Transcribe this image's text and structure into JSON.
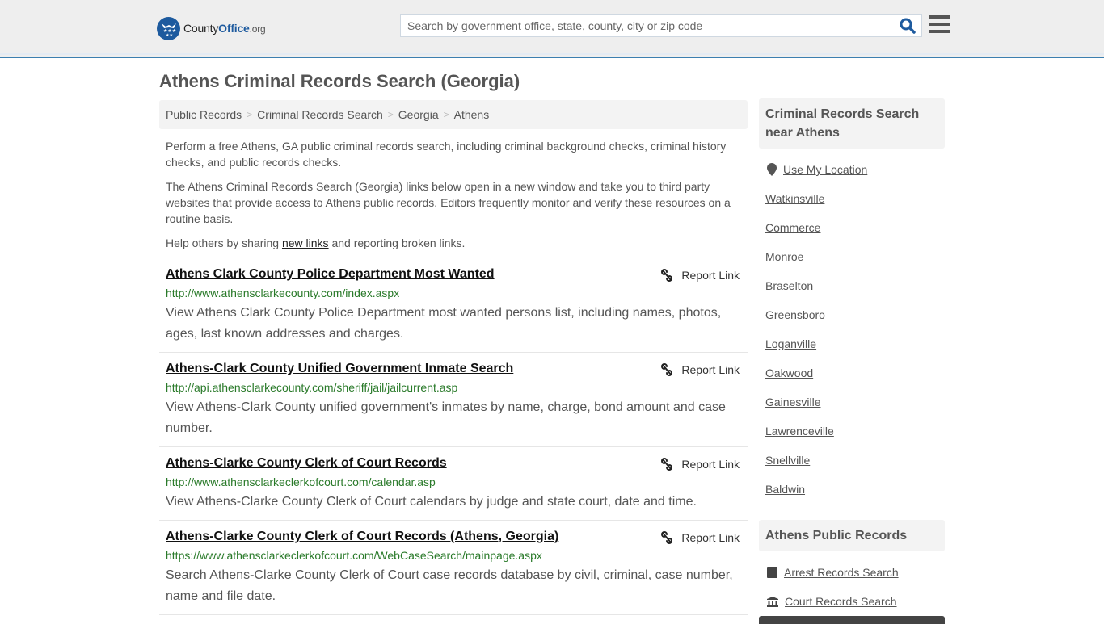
{
  "header": {
    "logo": {
      "name_dark": "County",
      "name_blue": "Office",
      "suffix": ".org"
    },
    "search": {
      "placeholder": "Search by government office, state, county, city or zip code",
      "value": ""
    },
    "icons": {
      "search": "search-icon",
      "menu": "hamburger-menu-icon"
    }
  },
  "page": {
    "title": "Athens Criminal Records Search (Georgia)"
  },
  "breadcrumb": {
    "separator": ">",
    "items": [
      "Public Records",
      "Criminal Records Search",
      "Georgia",
      "Athens"
    ]
  },
  "intro": {
    "p1": "Perform a free Athens, GA public criminal records search, including criminal background checks, criminal history checks, and public records checks.",
    "p2": "The Athens Criminal Records Search (Georgia) links below open in a new window and take you to third party websites that provide access to Athens public records. Editors frequently monitor and verify these resources on a routine basis.",
    "p3_before": "Help others by sharing ",
    "p3_link": "new links",
    "p3_after": " and reporting broken links."
  },
  "listings": [
    {
      "title": "Athens Clark County Police Department Most Wanted",
      "url": "http://www.athensclarkecounty.com/index.aspx",
      "description": "View Athens Clark County Police Department most wanted persons list, including names, photos, ages, last known addresses and charges.",
      "report_label": "Report Link"
    },
    {
      "title": "Athens-Clark County Unified Government Inmate Search",
      "url": "http://api.athensclarkecounty.com/sheriff/jail/jailcurrent.asp",
      "description": "View Athens-Clark County unified government's inmates by name, charge, bond amount and case number.",
      "report_label": "Report Link"
    },
    {
      "title": "Athens-Clarke County Clerk of Court Records",
      "url": "http://www.athensclarkeclerkofcourt.com/calendar.asp",
      "description": "View Athens-Clarke County Clerk of Court calendars by judge and state court, date and time.",
      "report_label": "Report Link"
    },
    {
      "title": "Athens-Clarke County Clerk of Court Records (Athens, Georgia)",
      "url": "https://www.athensclarkeclerkofcourt.com/WebCaseSearch/mainpage.aspx",
      "description": "Search Athens-Clarke County Clerk of Court case records database by civil, criminal, case number, name and file date.",
      "report_label": "Report Link"
    }
  ],
  "sidebar": {
    "nearby": {
      "heading": "Criminal Records Search near Athens",
      "use_location": "Use My Location",
      "cities": [
        "Watkinsville",
        "Commerce",
        "Monroe",
        "Braselton",
        "Greensboro",
        "Loganville",
        "Oakwood",
        "Gainesville",
        "Lawrenceville",
        "Snellville",
        "Baldwin"
      ]
    },
    "public_records": {
      "heading": "Athens Public Records",
      "links": [
        {
          "label": "Arrest Records Search",
          "icon": "square-icon"
        },
        {
          "label": "Court Records Search",
          "icon": "courthouse-icon"
        }
      ]
    }
  },
  "colors": {
    "accent": "#3b7fb0",
    "brand_blue": "#1d5a9e",
    "url_green": "#2a7a2a",
    "text": "#555555"
  }
}
